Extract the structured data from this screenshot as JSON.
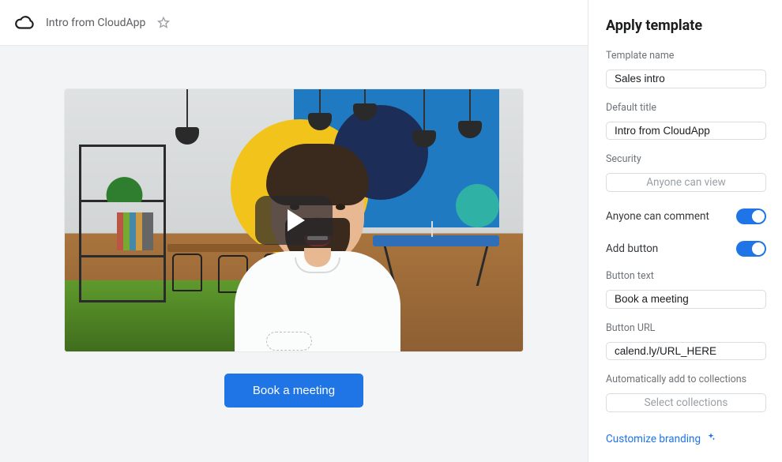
{
  "topbar": {
    "title": "Intro from CloudApp"
  },
  "cta": {
    "label": "Book a meeting"
  },
  "sidebar": {
    "heading": "Apply template",
    "template_name": {
      "label": "Template name",
      "value": "Sales intro"
    },
    "default_title": {
      "label": "Default title",
      "value": "Intro from CloudApp"
    },
    "security": {
      "label": "Security",
      "value": "Anyone can view"
    },
    "toggles": {
      "comment": {
        "label": "Anyone can comment",
        "on": true
      },
      "add_button": {
        "label": "Add button",
        "on": true
      }
    },
    "button_text": {
      "label": "Button text",
      "value": "Book a meeting"
    },
    "button_url": {
      "label": "Button URL",
      "value": "calend.ly/URL_HERE"
    },
    "collections": {
      "label": "Automatically add to collections",
      "placeholder": "Select collections"
    },
    "branding_link": "Customize branding"
  }
}
